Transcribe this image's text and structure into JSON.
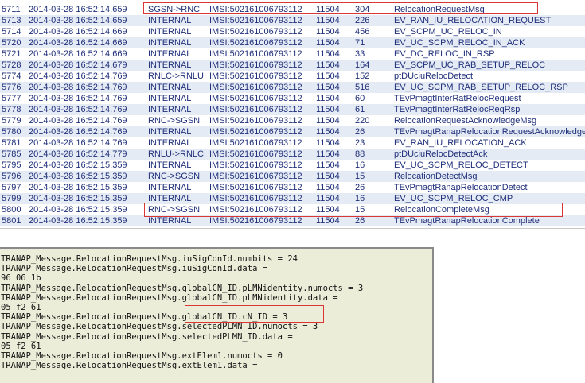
{
  "colors": {
    "row_text": "#1f2f7a",
    "alt_row_bg": "#e5ebf5",
    "highlight": "#d93636",
    "decode_bg": "#ecedd8"
  },
  "message_log": {
    "rows": [
      {
        "id": "5711",
        "time": "2014-03-28 16:52:14.659",
        "direction": "SGSN->RNC",
        "imsi": "IMSI:502161006793112",
        "code": "11504",
        "length": "304",
        "message": "RelocationRequestMsg"
      },
      {
        "id": "5713",
        "time": "2014-03-28 16:52:14.659",
        "direction": "INTERNAL",
        "imsi": "IMSI:502161006793112",
        "code": "11504",
        "length": "226",
        "message": "EV_RAN_IU_RELOCATION_REQUEST"
      },
      {
        "id": "5714",
        "time": "2014-03-28 16:52:14.669",
        "direction": "INTERNAL",
        "imsi": "IMSI:502161006793112",
        "code": "11504",
        "length": "456",
        "message": "EV_SCPM_UC_RELOC_IN"
      },
      {
        "id": "5720",
        "time": "2014-03-28 16:52:14.669",
        "direction": "INTERNAL",
        "imsi": "IMSI:502161006793112",
        "code": "11504",
        "length": "71",
        "message": "EV_UC_SCPM_RELOC_IN_ACK"
      },
      {
        "id": "5721",
        "time": "2014-03-28 16:52:14.669",
        "direction": "INTERNAL",
        "imsi": "IMSI:502161006793112",
        "code": "11504",
        "length": "33",
        "message": "EV_DC_RELOC_IN_RSP"
      },
      {
        "id": "5728",
        "time": "2014-03-28 16:52:14.679",
        "direction": "INTERNAL",
        "imsi": "IMSI:502161006793112",
        "code": "11504",
        "length": "164",
        "message": "EV_SCPM_UC_RAB_SETUP_RELOC"
      },
      {
        "id": "5774",
        "time": "2014-03-28 16:52:14.769",
        "direction": "RNLC->RNLU",
        "imsi": "IMSI:502161006793112",
        "code": "11504",
        "length": "152",
        "message": "ptDUciuRelocDetect"
      },
      {
        "id": "5776",
        "time": "2014-03-28 16:52:14.769",
        "direction": "INTERNAL",
        "imsi": "IMSI:502161006793112",
        "code": "11504",
        "length": "516",
        "message": "EV_UC_SCPM_RAB_SETUP_RELOC_RSP"
      },
      {
        "id": "5777",
        "time": "2014-03-28 16:52:14.769",
        "direction": "INTERNAL",
        "imsi": "IMSI:502161006793112",
        "code": "11504",
        "length": "60",
        "message": "TEvPmagtInterRatRelocRequest"
      },
      {
        "id": "5778",
        "time": "2014-03-28 16:52:14.769",
        "direction": "INTERNAL",
        "imsi": "IMSI:502161006793112",
        "code": "11504",
        "length": "61",
        "message": "TEvPmagtInterRatRelocReqRsp"
      },
      {
        "id": "5779",
        "time": "2014-03-28 16:52:14.769",
        "direction": "RNC->SGSN",
        "imsi": "IMSI:502161006793112",
        "code": "11504",
        "length": "220",
        "message": "RelocationRequestAcknowledgeMsg"
      },
      {
        "id": "5780",
        "time": "2014-03-28 16:52:14.769",
        "direction": "INTERNAL",
        "imsi": "IMSI:502161006793112",
        "code": "11504",
        "length": "26",
        "message": "TEvPmagtRanapRelocationRequestAcknowledge"
      },
      {
        "id": "5781",
        "time": "2014-03-28 16:52:14.769",
        "direction": "INTERNAL",
        "imsi": "IMSI:502161006793112",
        "code": "11504",
        "length": "23",
        "message": "EV_RAN_IU_RELOCATION_ACK"
      },
      {
        "id": "5785",
        "time": "2014-03-28 16:52:14.779",
        "direction": "RNLU->RNLC",
        "imsi": "IMSI:502161006793112",
        "code": "11504",
        "length": "88",
        "message": "ptDUciuRelocDetectAck"
      },
      {
        "id": "5795",
        "time": "2014-03-28 16:52:15.359",
        "direction": "INTERNAL",
        "imsi": "IMSI:502161006793112",
        "code": "11504",
        "length": "16",
        "message": "EV_UC_SCPM_RELOC_DETECT"
      },
      {
        "id": "5796",
        "time": "2014-03-28 16:52:15.359",
        "direction": "RNC->SGSN",
        "imsi": "IMSI:502161006793112",
        "code": "11504",
        "length": "15",
        "message": "RelocationDetectMsg"
      },
      {
        "id": "5797",
        "time": "2014-03-28 16:52:15.359",
        "direction": "INTERNAL",
        "imsi": "IMSI:502161006793112",
        "code": "11504",
        "length": "26",
        "message": "TEvPmagtRanapRelocationDetect"
      },
      {
        "id": "5799",
        "time": "2014-03-28 16:52:15.359",
        "direction": "INTERNAL",
        "imsi": "IMSI:502161006793112",
        "code": "11504",
        "length": "16",
        "message": "EV_UC_SCPM_RELOC_CMP"
      },
      {
        "id": "5800",
        "time": "2014-03-28 16:52:15.359",
        "direction": "RNC->SGSN",
        "imsi": "IMSI:502161006793112",
        "code": "11504",
        "length": "15",
        "message": "RelocationCompleteMsg"
      },
      {
        "id": "5801",
        "time": "2014-03-28 16:52:15.359",
        "direction": "INTERNAL",
        "imsi": "IMSI:502161006793112",
        "code": "11504",
        "length": "26",
        "message": "TEvPmagtRanapRelocationComplete"
      }
    ]
  },
  "decode": {
    "lines": [
      "TRANAP_Message.RelocationRequestMsg.iuSigConId.numbits = 24",
      "TRANAP_Message.RelocationRequestMsg.iuSigConId.data =",
      "96 06 1b",
      "TRANAP_Message.RelocationRequestMsg.globalCN_ID.pLMNidentity.numocts = 3",
      "TRANAP_Message.RelocationRequestMsg.globalCN_ID.pLMNidentity.data =",
      "05 f2 61",
      "TRANAP_Message.RelocationRequestMsg.globalCN_ID.cN_ID = 3",
      "TRANAP_Message.RelocationRequestMsg.selectedPLMN_ID.numocts = 3",
      "TRANAP_Message.RelocationRequestMsg.selectedPLMN_ID.data =",
      "05 f2 61",
      "TRANAP_Message.RelocationRequestMsg.extElem1.numocts = 0",
      "TRANAP_Message.RelocationRequestMsg.extElem1.data ="
    ]
  }
}
